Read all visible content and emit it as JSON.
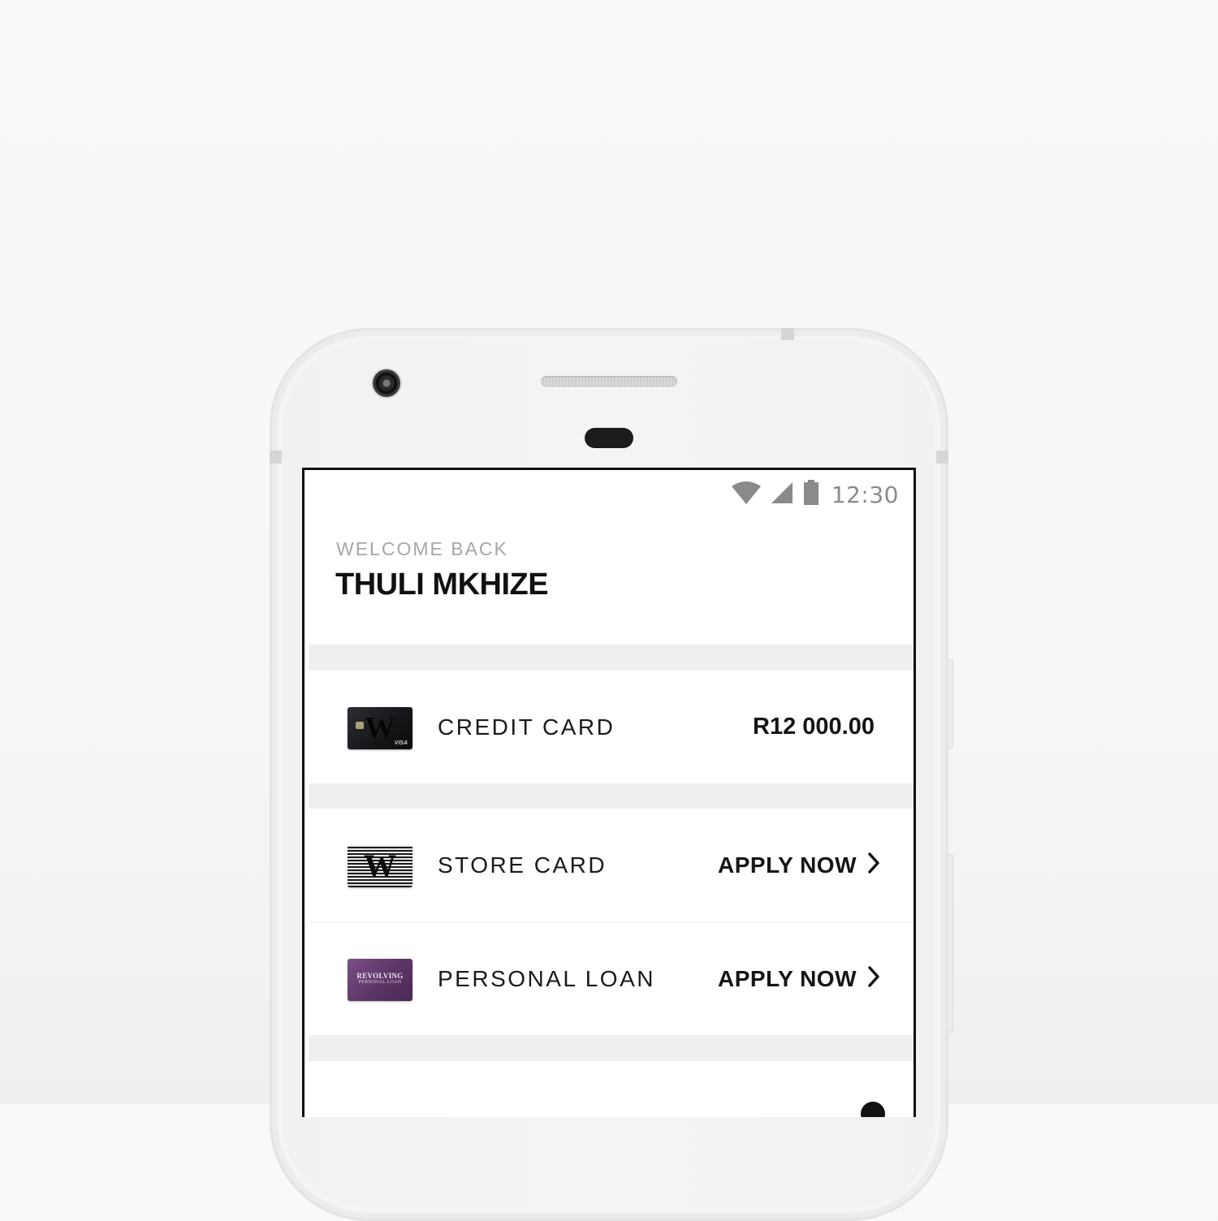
{
  "status_bar": {
    "time": "12:30",
    "icons": [
      "wifi-icon",
      "signal-icon",
      "battery-icon"
    ]
  },
  "header": {
    "welcome": "WELCOME BACK",
    "user_name": "THULI MKHIZE"
  },
  "products": [
    {
      "label": "CREDIT CARD",
      "value": "R12 000.00",
      "thumb_text": "W"
    },
    {
      "label": "STORE CARD",
      "action": "APPLY NOW",
      "thumb_text": "W"
    },
    {
      "label": "PERSONAL LOAN",
      "action": "APPLY NOW",
      "thumb_text": "REVOLVING",
      "thumb_subtext": "PERSONAL LOAN"
    }
  ],
  "colors": {
    "background": "#f8f8f8",
    "band": "#efefef",
    "text_primary": "#151515",
    "text_muted": "#a7a7a7",
    "loan_card": "#5b3566"
  }
}
